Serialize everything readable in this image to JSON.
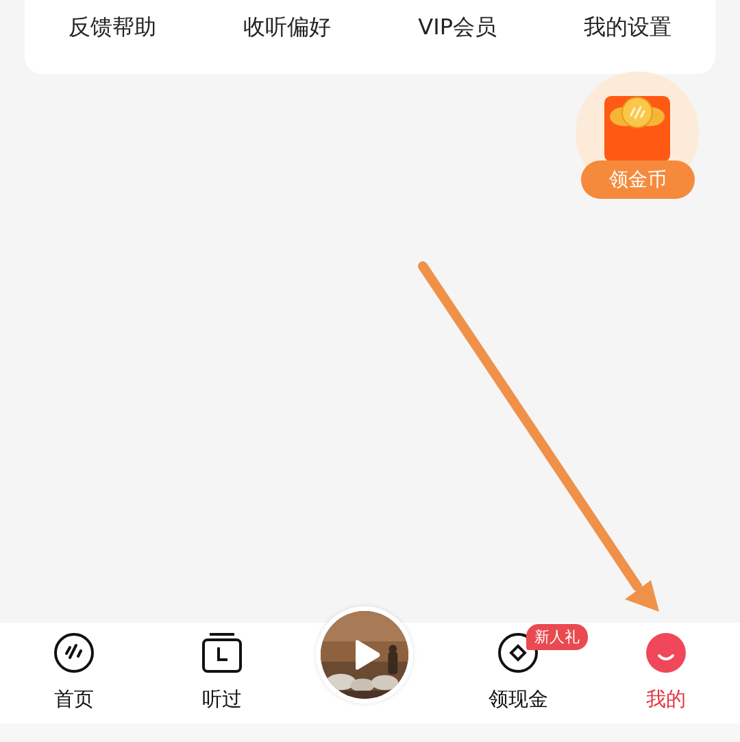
{
  "top_menu": {
    "items": [
      {
        "label": "反馈帮助"
      },
      {
        "label": "收听偏好"
      },
      {
        "label": "VIP会员"
      },
      {
        "label": "我的设置"
      }
    ]
  },
  "coin_widget": {
    "label": "领金币"
  },
  "tab_bar": {
    "tabs": [
      {
        "kind": "home",
        "label": "首页",
        "selected": false
      },
      {
        "kind": "history",
        "label": "听过",
        "selected": false
      },
      {
        "kind": "player"
      },
      {
        "kind": "cash",
        "label": "领现金",
        "selected": false,
        "badge": "新人礼"
      },
      {
        "kind": "profile",
        "label": "我的",
        "selected": true
      }
    ]
  }
}
